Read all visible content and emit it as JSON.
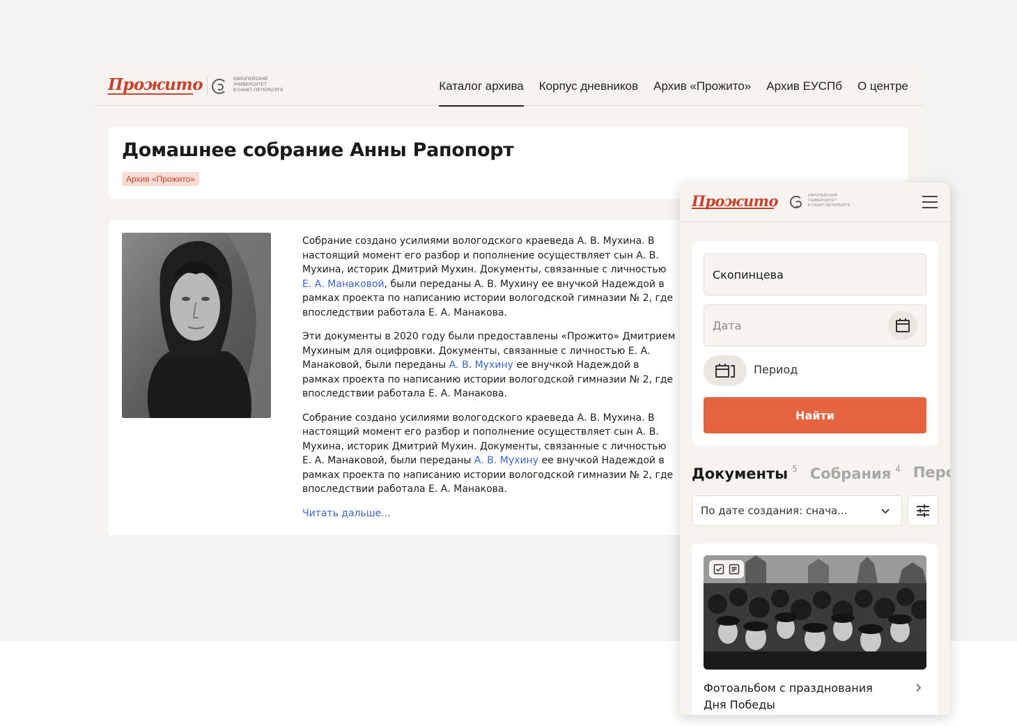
{
  "desktop": {
    "logo": "Прожито",
    "eu_text": [
      "ЕВРОПЕЙСКИЙ",
      "УНИВЕРСИТЕТ",
      "В САНКТ-ПЕТЕРБУРГЕ"
    ],
    "nav": [
      "Каталог архива",
      "Корпус дневников",
      "Архив «Прожито»",
      "Архив ЕУСПб",
      "О центре"
    ],
    "active_nav": "Каталог архива",
    "title": "Домашнее собрание Анны Рапопорт",
    "badge": "Архив «Прожито»",
    "paragraphs": [
      {
        "before": "Собрание создано усилиями вологодского краеведа А. В. Мухина. В настоящий момент его разбор и пополнение осуществляет сын А. В. Мухина, историк Дмитрий Мухин. Документы, связанные с личностью ",
        "link": "Е. А. Манаковой",
        "after": ", были переданы А. В. Мухину ее внучкой Надеждой в рамках проекта по написанию истории вологодской гимназии № 2, где впоследствии работала Е. А. Манакова."
      },
      {
        "before": "Эти документы в 2020 году были предоставлены «Прожито» Дмитрием Мухиным для оцифровки. Документы, связанные с личностью Е. А. Манаковой, были переданы ",
        "link": "А. В. Мухину",
        "after": " ее внучкой Надеждой в рамках проекта по написанию истории вологодской гимназии № 2, где впоследствии работала Е. А. Манакова."
      },
      {
        "before": "Собрание создано усилиями вологодского краеведа А. В. Мухина. В настоящий момент его разбор и пополнение осуществляет сын А. В. Мухина, историк Дмитрий Мухин. Документы, связанные с личностью Е. А. Манаковой, были переданы ",
        "link": "А. В. Мухину",
        "after": " ее внучкой Надеждой в рамках проекта по написанию истории вологодской гимназии № 2, где впоследствии работала Е. А. Манакова."
      }
    ],
    "read_more": "Читать дальше..."
  },
  "mobile": {
    "logo": "Прожито",
    "eu_text": [
      "ЕВРОПЕЙСКИЙ",
      "УНИВЕРСИТЕТ",
      "В САНКТ-ПЕТЕРБУРГЕ"
    ],
    "search_value": "Скопинцева",
    "date_placeholder": "Дата",
    "period_label": "Период",
    "submit_label": "Найти",
    "tabs": [
      {
        "label": "Документы",
        "count": "5"
      },
      {
        "label": "Собрания",
        "count": "4"
      },
      {
        "label": "Персо",
        "count": ""
      }
    ],
    "sort_label": "По дате создания: снача...",
    "card_title": "Фотоальбом с празднования Дня Победы"
  },
  "colors": {
    "brand": "#c8412b",
    "accent_button": "#e4643f",
    "link": "#3b66c4",
    "page_bg": "#f7f4ef"
  }
}
